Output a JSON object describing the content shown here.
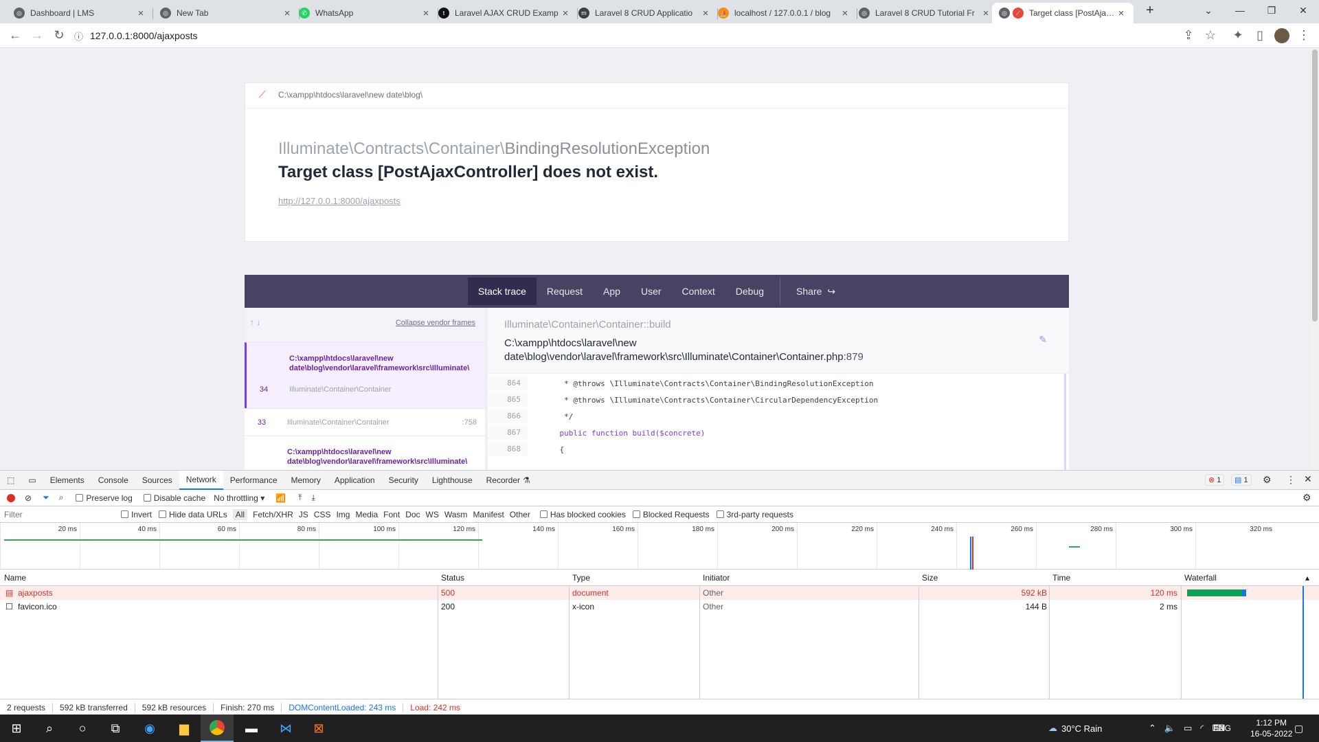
{
  "browser": {
    "tabs": [
      {
        "title": "Dashboard | LMS",
        "color": "#5f6368"
      },
      {
        "title": "New Tab",
        "color": "#5f6368"
      },
      {
        "title": "WhatsApp",
        "color": "#25d366"
      },
      {
        "title": "Laravel AJAX CRUD Examp",
        "color": "#111111"
      },
      {
        "title": "Laravel 8 CRUD Applicatio",
        "color": "#3c4043"
      },
      {
        "title": "localhost / 127.0.0.1 / blog",
        "color": "#f29111"
      },
      {
        "title": "Laravel 8 CRUD Tutorial Fr",
        "color": "#5f6368"
      },
      {
        "title": "Target class [PostAjaxC",
        "color": "#e8453c"
      }
    ],
    "url": "127.0.0.1:8000/ajaxposts"
  },
  "ignition": {
    "app_path": "C:\\xampp\\htdocs\\laravel\\new date\\blog\\",
    "exception_namespace": "Illuminate\\Contracts\\Container\\",
    "exception_class": "BindingResolutionException",
    "message": "Target class [PostAjaxController] does not exist.",
    "request_url": "http://127.0.0.1:8000/ajaxposts",
    "nav": [
      "Stack trace",
      "Request",
      "App",
      "User",
      "Context",
      "Debug"
    ],
    "share": "Share",
    "collapse": "Collapse vendor frames",
    "frames": [
      {
        "path": "C:\\xampp\\htdocs\\laravel\\new date\\blog\\vendor\\laravel\\framework\\src\\Illuminate\\",
        "num": "34",
        "cls": "Illuminate\\Container\\Container",
        "line": ""
      },
      {
        "path": "",
        "num": "33",
        "cls": "Illuminate\\Container\\Container",
        "line": ":758"
      },
      {
        "path": "C:\\xampp\\htdocs\\laravel\\new date\\blog\\vendor\\laravel\\framework\\src\\Illuminate\\",
        "num": "",
        "cls": "",
        "line": ""
      }
    ],
    "method": "Illuminate\\Container\\Container::build",
    "file_line1": "C:\\xampp\\htdocs\\laravel\\new",
    "file_line2": "date\\blog\\vendor\\laravel\\framework\\src\\Illuminate\\Container\\Container.php",
    "file_lineno": ":879",
    "code": [
      {
        "n": "864",
        "t": "     * @throws \\Illuminate\\Contracts\\Container\\BindingResolutionException"
      },
      {
        "n": "865",
        "t": "     * @throws \\Illuminate\\Contracts\\Container\\CircularDependencyException"
      },
      {
        "n": "866",
        "t": "     */"
      },
      {
        "n": "867",
        "t": "    public function build($concrete)"
      },
      {
        "n": "868",
        "t": "    {"
      }
    ]
  },
  "devtools": {
    "tabs": [
      "Elements",
      "Console",
      "Sources",
      "Network",
      "Performance",
      "Memory",
      "Application",
      "Security",
      "Lighthouse",
      "Recorder"
    ],
    "errors": "1",
    "messages": "1",
    "preserve_log": "Preserve log",
    "disable_cache": "Disable cache",
    "throttling": "No throttling",
    "filter_placeholder": "Filter",
    "invert": "Invert",
    "hide_data_urls": "Hide data URLs",
    "types": [
      "All",
      "Fetch/XHR",
      "JS",
      "CSS",
      "Img",
      "Media",
      "Font",
      "Doc",
      "WS",
      "Wasm",
      "Manifest",
      "Other"
    ],
    "has_blocked_cookies": "Has blocked cookies",
    "blocked_requests": "Blocked Requests",
    "third_party": "3rd-party requests",
    "ticks": [
      "20 ms",
      "40 ms",
      "60 ms",
      "80 ms",
      "100 ms",
      "120 ms",
      "140 ms",
      "160 ms",
      "180 ms",
      "200 ms",
      "220 ms",
      "240 ms",
      "260 ms",
      "280 ms",
      "300 ms",
      "320 ms"
    ],
    "columns": [
      "Name",
      "Status",
      "Type",
      "Initiator",
      "Size",
      "Time",
      "Waterfall"
    ],
    "rows": [
      {
        "name": "ajaxposts",
        "status": "500",
        "type": "document",
        "initiator": "Other",
        "size": "592 kB",
        "time": "120 ms"
      },
      {
        "name": "favicon.ico",
        "status": "200",
        "type": "x-icon",
        "initiator": "Other",
        "size": "144 B",
        "time": "2 ms"
      }
    ],
    "summary": {
      "requests": "2 requests",
      "transferred": "592 kB transferred",
      "resources": "592 kB resources",
      "finish": "Finish: 270 ms",
      "dcl": "DOMContentLoaded: 243 ms",
      "load": "Load: 242 ms"
    }
  },
  "taskbar": {
    "weather": "30°C  Rain",
    "lang": "ENG",
    "time": "1:12 PM",
    "date": "16-05-2022"
  }
}
